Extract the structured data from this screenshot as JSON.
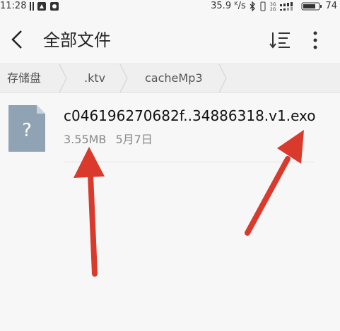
{
  "status_bar": {
    "time": "11:28",
    "data_speed": "35.9 ᴷ/s",
    "battery": "74"
  },
  "header": {
    "title": "全部文件"
  },
  "breadcrumb": [
    "存储盘",
    ".ktv",
    "cacheMp3"
  ],
  "files": [
    {
      "name": "c046196270682f..34886318.v1.exo",
      "size": "3.55MB",
      "date": "5月7日",
      "icon": "unknown-file-icon"
    }
  ],
  "colors": {
    "annotation_arrow": "#d93a2c",
    "file_icon": "#8fa3b5"
  }
}
